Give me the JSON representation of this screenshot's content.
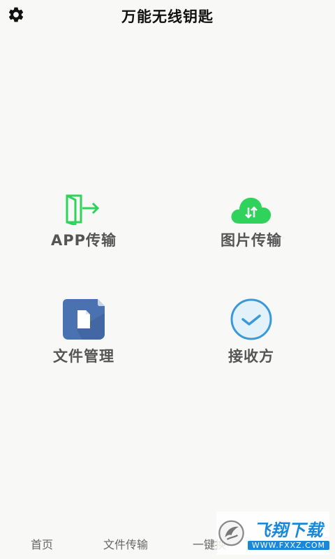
{
  "header": {
    "title": "万能无线钥匙",
    "settings_icon": "gear-icon"
  },
  "tiles": [
    {
      "label": "APP传输",
      "icon": "app-transfer-icon"
    },
    {
      "label": "图片传输",
      "icon": "cloud-transfer-icon"
    },
    {
      "label": "文件管理",
      "icon": "file-manager-icon"
    },
    {
      "label": "接收方",
      "icon": "check-circle-icon"
    }
  ],
  "bottom_nav": {
    "items": [
      "首页",
      "文件传输",
      "一键换"
    ]
  },
  "watermark": {
    "main": "飞翔下载",
    "url": "WWW.FXXZ.COM"
  },
  "colors": {
    "background": "#f8f8f6",
    "green": "#2fd25a",
    "blue_tile": "#4a72b0",
    "check_blue": "#3a9ad9"
  }
}
